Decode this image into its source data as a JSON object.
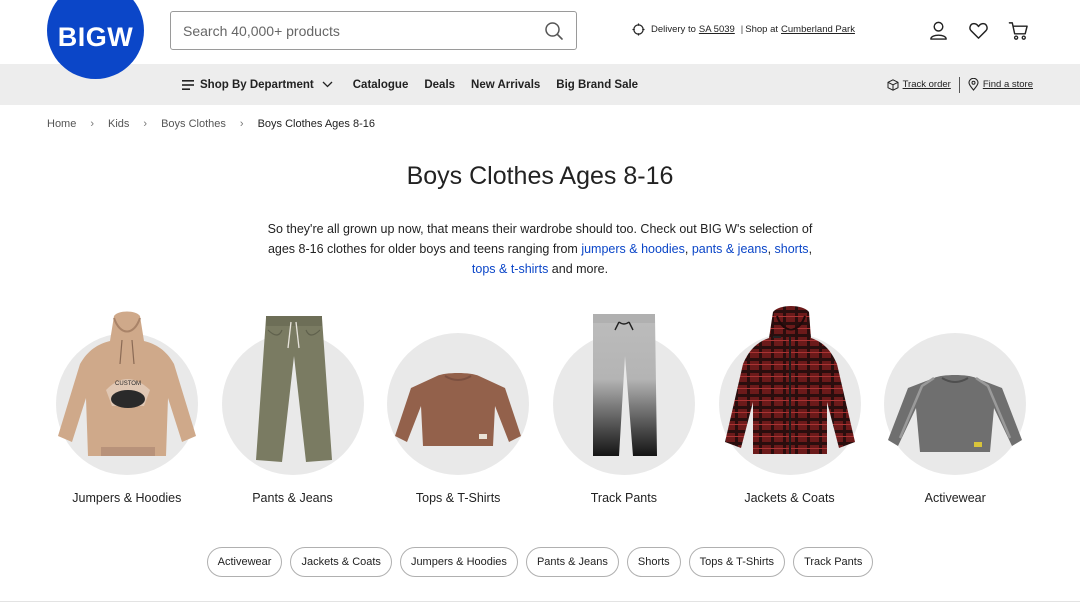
{
  "brand": {
    "logo_text": "BIGW",
    "color": "#0b46c8"
  },
  "search": {
    "placeholder": "Search 40,000+ products"
  },
  "delivery": {
    "prefix": "Delivery to",
    "postcode": "SA 5039",
    "sep": "|",
    "shop_prefix": "Shop at",
    "store": "Cumberland Park"
  },
  "header_icons": [
    "account-icon",
    "heart-icon",
    "cart-icon"
  ],
  "nav": {
    "items": [
      {
        "label": "Shop By Department"
      },
      {
        "label": "Catalogue"
      },
      {
        "label": "Deals"
      },
      {
        "label": "New Arrivals"
      },
      {
        "label": "Big Brand Sale"
      }
    ],
    "track_order": "Track order",
    "find_store": "Find a store"
  },
  "breadcrumb": [
    "Home",
    "Kids",
    "Boys Clothes",
    "Boys Clothes Ages 8-16"
  ],
  "page": {
    "title": "Boys Clothes Ages 8-16",
    "desc_part1": "So they're all grown up now, that means their wardrobe should too. Check out BIG W's selection of ages 8-16 clothes for older boys and teens ranging from ",
    "link1": "jumpers & hoodies",
    "comma1": ", ",
    "link2": "pants & jeans",
    "comma2": ", ",
    "link3": "shorts",
    "comma3": ", ",
    "link4": "tops & t-shirts",
    "desc_end": " and more."
  },
  "categories": [
    {
      "label": "Jumpers & Hoodies"
    },
    {
      "label": "Pants & Jeans"
    },
    {
      "label": "Tops & T-Shirts"
    },
    {
      "label": "Track Pants"
    },
    {
      "label": "Jackets & Coats"
    },
    {
      "label": "Activewear"
    }
  ],
  "chips": [
    "Activewear",
    "Jackets & Coats",
    "Jumpers & Hoodies",
    "Pants & Jeans",
    "Shorts",
    "Tops & T-Shirts",
    "Track Pants"
  ]
}
